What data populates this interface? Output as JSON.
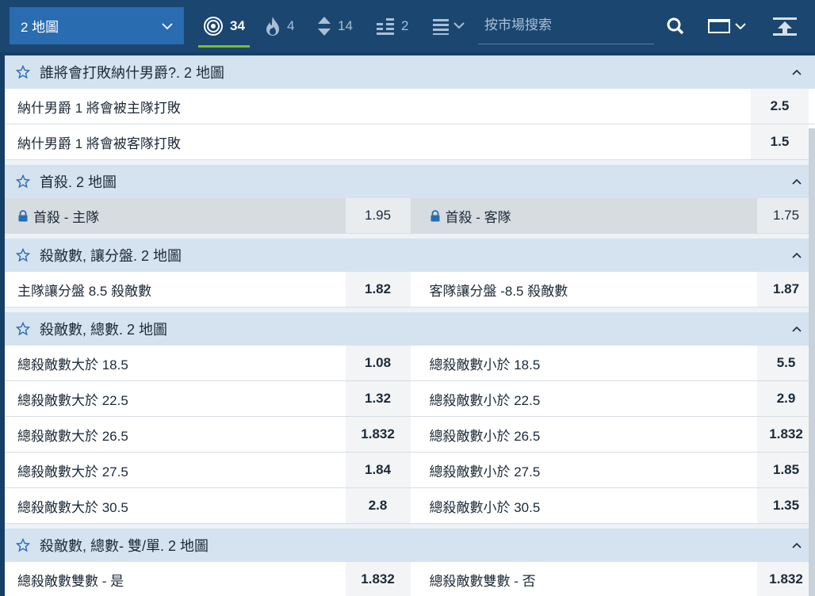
{
  "topbar": {
    "map_select": "2 地圖",
    "tabs": [
      {
        "icon": "target-icon",
        "count": "34",
        "active": true
      },
      {
        "icon": "flame-icon",
        "count": "4",
        "active": false
      },
      {
        "icon": "updown-arrows-icon",
        "count": "14",
        "active": false
      },
      {
        "icon": "bars-icon",
        "count": "2",
        "active": false
      }
    ],
    "search_placeholder": "按市場搜索"
  },
  "markets": [
    {
      "title": "誰將會打敗納什男爵?. 2 地圖",
      "layout": "single",
      "rows": [
        [
          {
            "label": "納什男爵 1 將會被主隊打敗",
            "odds": "2.5"
          }
        ],
        [
          {
            "label": "納什男爵 1 將會被客隊打敗",
            "odds": "1.5"
          }
        ]
      ]
    },
    {
      "title": "首殺. 2 地圖",
      "layout": "double",
      "locked": true,
      "rows": [
        [
          {
            "label": "首殺 - 主隊",
            "odds": "1.95"
          },
          {
            "label": "首殺 - 客隊",
            "odds": "1.75"
          }
        ]
      ]
    },
    {
      "title": "殺敵數, 讓分盤. 2 地圖",
      "layout": "double",
      "rows": [
        [
          {
            "label": "主隊讓分盤 8.5 殺敵數",
            "odds": "1.82"
          },
          {
            "label": "客隊讓分盤 -8.5 殺敵數",
            "odds": "1.87"
          }
        ]
      ]
    },
    {
      "title": "殺敵數, 總數. 2 地圖",
      "layout": "double",
      "rows": [
        [
          {
            "label": "總殺敵數大於 18.5",
            "odds": "1.08"
          },
          {
            "label": "總殺敵數小於 18.5",
            "odds": "5.5"
          }
        ],
        [
          {
            "label": "總殺敵數大於 22.5",
            "odds": "1.32"
          },
          {
            "label": "總殺敵數小於 22.5",
            "odds": "2.9"
          }
        ],
        [
          {
            "label": "總殺敵數大於 26.5",
            "odds": "1.832"
          },
          {
            "label": "總殺敵數小於 26.5",
            "odds": "1.832"
          }
        ],
        [
          {
            "label": "總殺敵數大於 27.5",
            "odds": "1.84"
          },
          {
            "label": "總殺敵數小於 27.5",
            "odds": "1.85"
          }
        ],
        [
          {
            "label": "總殺敵數大於 30.5",
            "odds": "2.8"
          },
          {
            "label": "總殺敵數小於 30.5",
            "odds": "1.35"
          }
        ]
      ]
    },
    {
      "title": "殺敵數, 總數- 雙/單. 2 地圖",
      "layout": "double",
      "rows": [
        [
          {
            "label": "總殺敵數雙數 - 是",
            "odds": "1.832"
          },
          {
            "label": "總殺敵數雙數 - 否",
            "odds": "1.832"
          }
        ]
      ]
    }
  ]
}
